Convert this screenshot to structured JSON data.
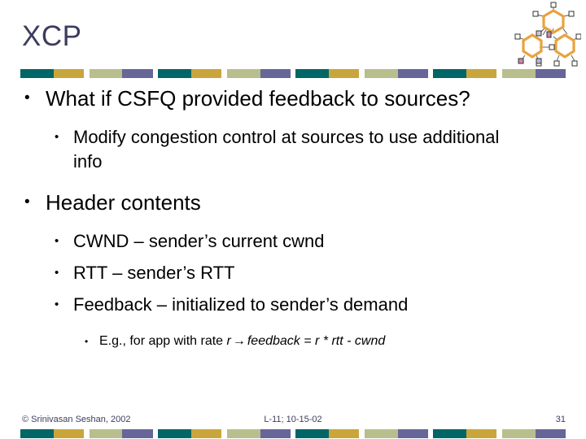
{
  "slide": {
    "title": "XCP",
    "title_color": "#3c3c5e"
  },
  "divider": {
    "colors": [
      "#006666",
      "#c9a63c",
      "#b8be8e",
      "#666699"
    ],
    "repeat_count": 4,
    "segment_labels": [
      "teal",
      "gold",
      "sage",
      "slate-purple"
    ]
  },
  "decoration": {
    "icon_name": "network-rings-graphic",
    "ring_color": "#e8a33d",
    "node_color": "#ffffff",
    "node_border": "#333333",
    "accent_colors": [
      "#cc88aa",
      "#b8b8d0",
      "#c8c8dd"
    ]
  },
  "content": [
    {
      "level": 1,
      "bullet": "•",
      "text": "What if CSFQ provided feedback to sources?"
    },
    {
      "level": 2,
      "bullet": "•",
      "text": "Modify congestion control at sources to use additional info"
    },
    {
      "level": 1,
      "bullet": "•",
      "text": "Header contents"
    },
    {
      "level": 2,
      "bullet": "•",
      "text": "CWND – sender’s current cwnd"
    },
    {
      "level": 2,
      "bullet": "•",
      "text": "RTT – sender’s RTT"
    },
    {
      "level": 2,
      "bullet": "•",
      "text": "Feedback – initialized to sender’s demand"
    }
  ],
  "formula_bullet": {
    "level": 3,
    "bullet": "•",
    "prefix": "E.g., for app with rate ",
    "var_rate": "r",
    "arrow": "→",
    "formula": "feedback = r * rtt - cwnd"
  },
  "footer": {
    "copyright": "© Srinivasan Seshan, 2002",
    "lecture": "L-11; 10-15-02",
    "page_number": "31",
    "color": "#3c3c5e"
  }
}
